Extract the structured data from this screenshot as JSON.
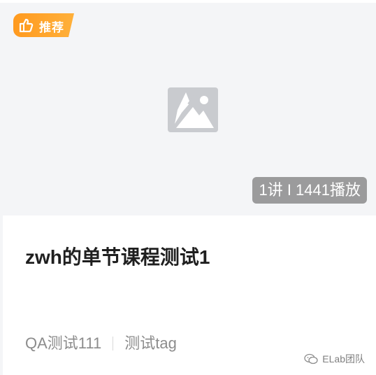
{
  "badge": {
    "label": "推荐",
    "icon": "recommend-icon",
    "color_start": "#ff9a1f",
    "color_end": "#ffb03a"
  },
  "cover": {
    "placeholder_icon": "image-placeholder-icon",
    "stats": "1讲 I 1441播放"
  },
  "course": {
    "title": "zwh的单节课程测试1"
  },
  "tags": {
    "first": "QA测试111",
    "second": "测试tag"
  },
  "watermark": {
    "icon": "wechat-icon",
    "text": "ELab团队"
  }
}
